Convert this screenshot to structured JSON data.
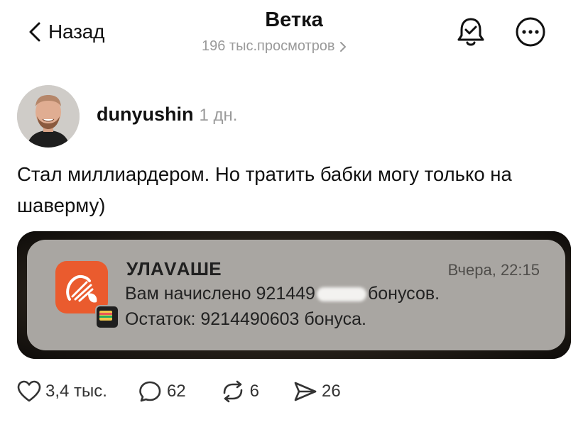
{
  "header": {
    "back_label": "Назад",
    "title": "Ветка",
    "views": "196 тыс.просмотров",
    "icons": [
      "back-chevron-icon",
      "notification-bell-icon",
      "more-options-icon",
      "chevron-right-icon"
    ]
  },
  "post": {
    "author": "dunyushin",
    "time": "1 дн.",
    "text": "Стал миллиардером. Но тратить бабки могу только на шаверму)",
    "image": {
      "notification": {
        "app_name": "УЛАVАШЕ",
        "time": "Вчера, 22:15",
        "line1_prefix": "Вам начислено 921449",
        "line1_suffix": "бонусов.",
        "line2": "Остаток: 9214490603 бонуса.",
        "app_color": "#ea5b2e"
      }
    }
  },
  "actions": {
    "likes": "3,4 тыс.",
    "comments": "62",
    "reposts": "6",
    "shares": "26"
  }
}
